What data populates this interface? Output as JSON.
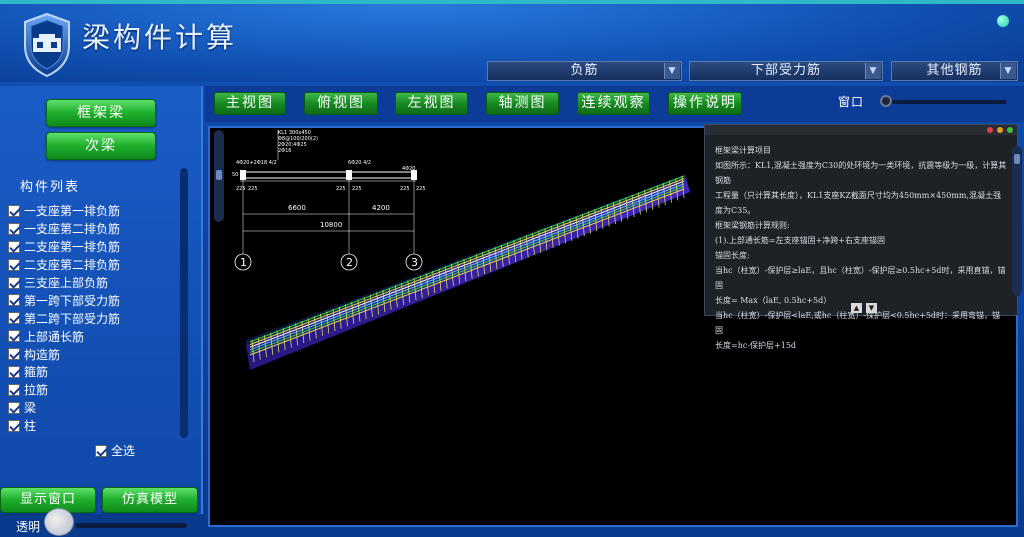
{
  "app": {
    "title": "梁构件计算",
    "menu_tabs": [
      "负筋",
      "下部受力筋",
      "其他钢筋"
    ]
  },
  "sidebar": {
    "frame_beam_button": "框架梁",
    "secondary_beam_button": "次梁",
    "list_title": "构件列表",
    "components": [
      "一支座第一排负筋",
      "一支座第二排负筋",
      "二支座第一排负筋",
      "二支座第二排负筋",
      "三支座上部负筋",
      "第一跨下部受力筋",
      "第二跨下部受力筋",
      "上部通长筋",
      "构造筋",
      "箍筋",
      "拉筋",
      "梁",
      "柱"
    ],
    "select_all": "全选",
    "show_window_button": "显示窗口",
    "simulation_button": "仿真模型",
    "transparency_label": "透明"
  },
  "toolbar": {
    "views": [
      "主视图",
      "俯视图",
      "左视图",
      "轴测图",
      "连续观察",
      "操作说明"
    ],
    "window_label": "窗口"
  },
  "drawing": {
    "beam_label": [
      "KL1 300x450",
      "Φ8@100/200(2)",
      "2Φ20;4Φ25",
      "2Φ16"
    ],
    "rebar_left": "4Φ20+2Φ18 4/2",
    "rebar_mid": "6Φ20 4/2",
    "rebar_right": "4Φ20",
    "dims_small": [
      "225",
      "225",
      "225",
      "225",
      "225",
      "225"
    ],
    "span1": "6600",
    "span2": "4200",
    "total": "10800",
    "axes": [
      "1",
      "2",
      "3"
    ]
  },
  "info": {
    "lines": [
      "框架梁计算项目",
      "如图所示：KL1,混凝土强度为C30的处环境为一类环境，抗震等级为一级，计算其钢筋",
      "工程量（只计算其长度），KL1支座KZ截面尺寸均为450mm×450mm,混凝土强度为C35。",
      "框架梁钢筋计算规则:",
      "(1).上部通长筋=左支座锚固+净跨+右支座锚固",
      "锚固长度:",
      "当hc（柱宽）-保护层≥laE，且hc（柱宽）-保护层≥0.5hc+5d时，采用直锚，锚固",
      "长度= Max（laE, 0.5hc+5d）",
      "当hc（柱宽）-保护层<laE,或hc（柱宽）-保护层<0.5hc+5d时：采用弯锚，锚固",
      "长度=hc-保护层+15d"
    ]
  }
}
